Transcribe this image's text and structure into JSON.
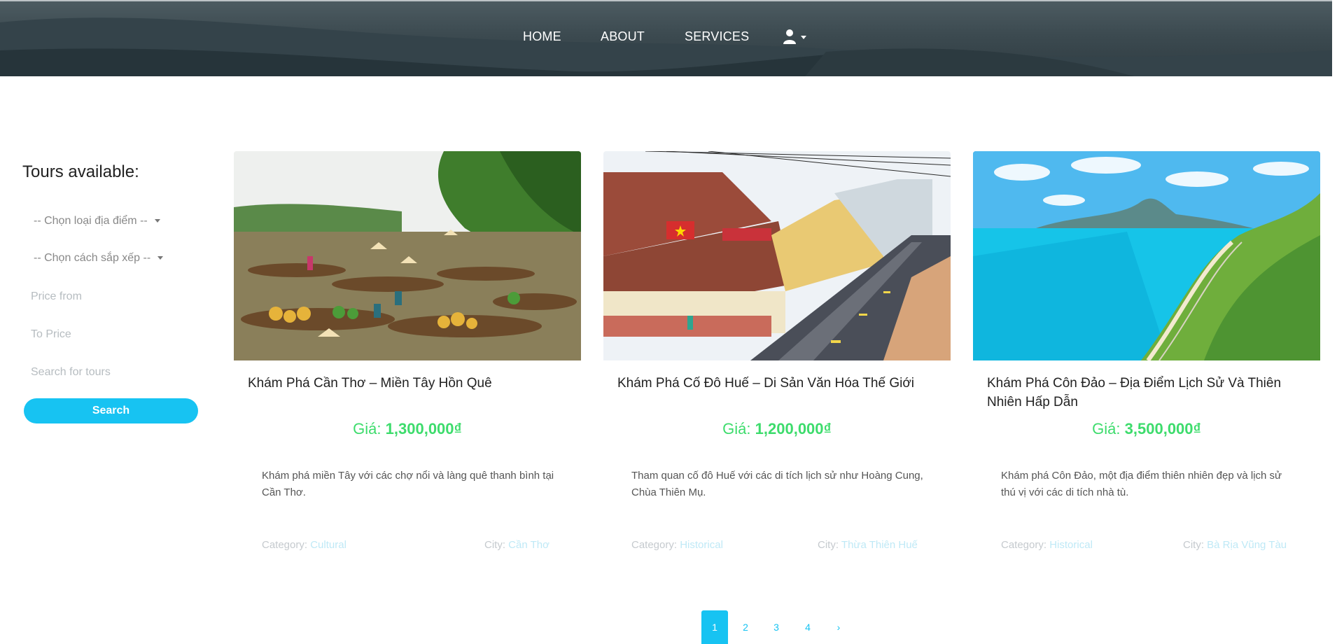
{
  "nav": {
    "home": "HOME",
    "about": "ABOUT",
    "services": "SERVICES",
    "user_icon": "user-icon",
    "dropdown_icon": "caret-down-icon"
  },
  "sidebar": {
    "title": "Tours available:",
    "place_type_select": "-- Chọn loại địa điểm --",
    "sort_select": "-- Chọn cách sắp xếp --",
    "price_from_placeholder": "Price from",
    "price_to_placeholder": "To Price",
    "search_placeholder": "Search for tours",
    "search_button": "Search"
  },
  "tours": [
    {
      "title": "Khám Phá Cần Thơ – Miền Tây Hồn Quê",
      "price_label": "Giá:",
      "price": "1,300,000₫",
      "description": "Khám phá miền Tây với các chợ nổi và làng quê thanh bình tại Cần Thơ.",
      "category_label": "Category:",
      "category": "Cultural",
      "city_label": "City:",
      "city": "Cần Thơ"
    },
    {
      "title": "Khám Phá Cố Đô Huế – Di Sản Văn Hóa Thế Giới",
      "price_label": "Giá:",
      "price": "1,200,000₫",
      "description": "Tham quan cố đô Huế với các di tích lịch sử như Hoàng Cung, Chùa Thiên Mụ.",
      "category_label": "Category:",
      "category": "Historical",
      "city_label": "City:",
      "city": "Thừa Thiên Huế"
    },
    {
      "title": "Khám Phá Côn Đảo – Địa Điểm Lịch Sử Và Thiên Nhiên Hấp Dẫn",
      "price_label": "Giá:",
      "price": "3,500,000₫",
      "description": "Khám phá Côn Đảo, một địa điểm thiên nhiên đẹp và lịch sử thú vị với các di tích nhà tù.",
      "category_label": "Category:",
      "category": "Historical",
      "city_label": "City:",
      "city": "Bà Rịa Vũng Tàu"
    }
  ],
  "pagination": {
    "pages": [
      "1",
      "2",
      "3",
      "4"
    ],
    "current": "1",
    "next": "›"
  }
}
